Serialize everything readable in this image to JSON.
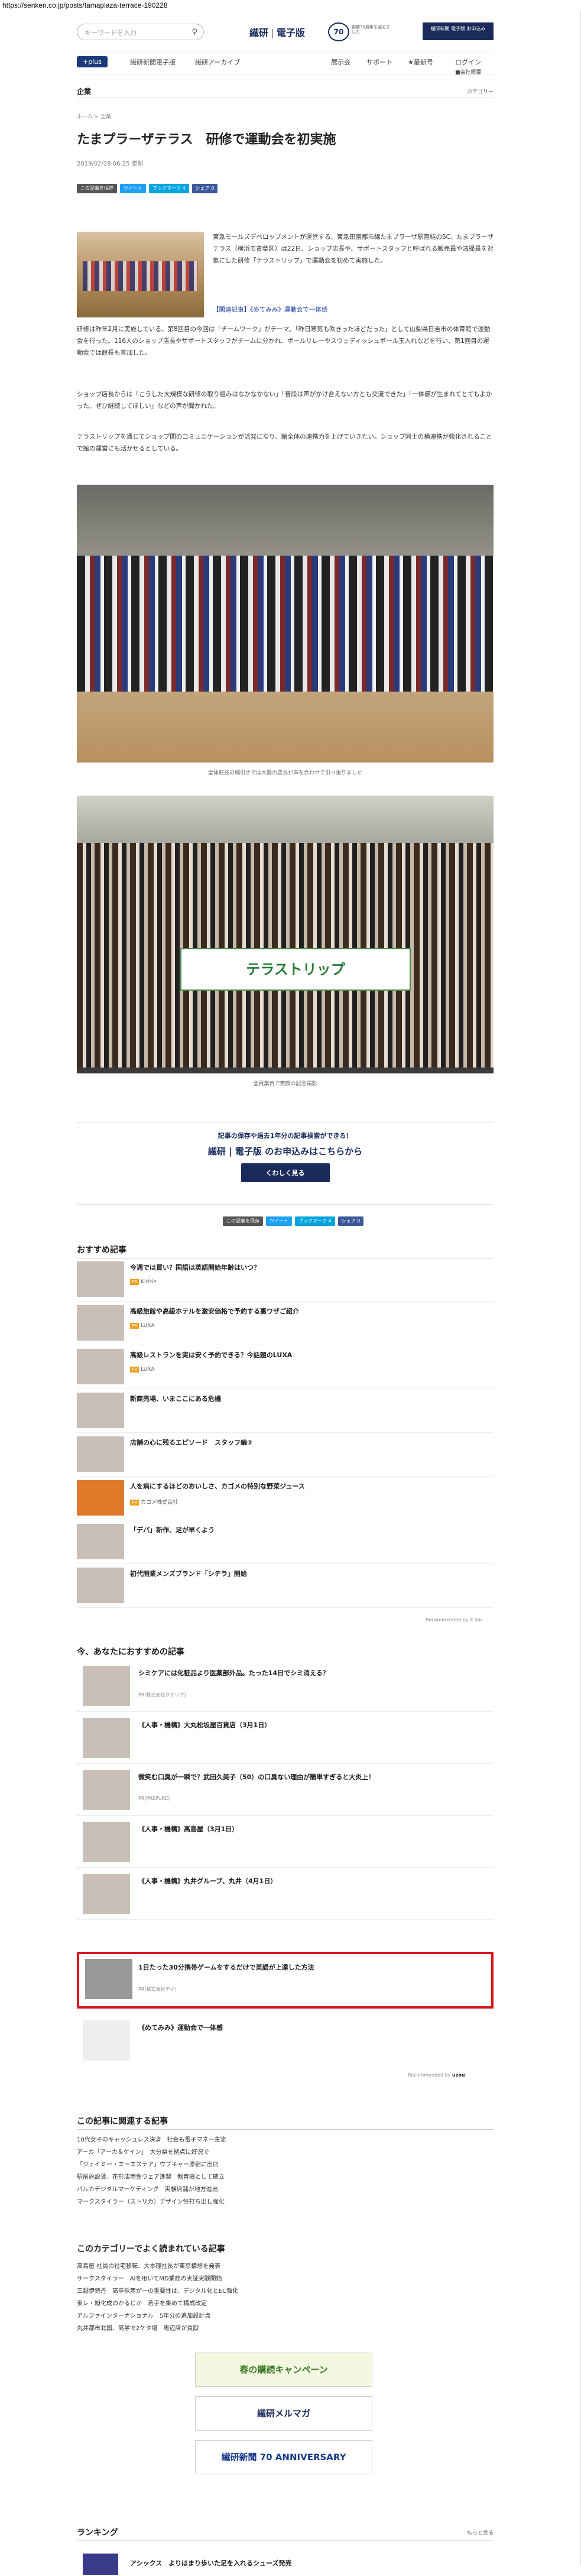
{
  "url": "https://senken.co.jp/posts/tamaplaza-terrace-190228",
  "header": {
    "search_placeholder": "キーワードを入力",
    "logo_main": "繊研",
    "logo_sub": "電子版",
    "anniv": "70",
    "logo_tagline": "創業70周年を迎えました",
    "right_label": "繊研新聞 電子版 お申込み"
  },
  "nav": {
    "plus": "+plus",
    "items": [
      "繊研新聞電子版",
      "繊研アーカイブ",
      "展示会",
      "サポート",
      "★最新号",
      "ログイン"
    ],
    "sub": "■会社概要"
  },
  "section": "企業",
  "category": "カテゴリー",
  "breadcrumb": "ホーム > 企業",
  "article": {
    "title": "たまプラーザテラス　研修で運動会を初実施",
    "date": "2019/02/28 06:25 更新",
    "p1": "東急モールズデベロップメントが運営する、東急田園都市線たまプラーザ駅直結のSC、たまプラーザテラス（横浜市青葉区）は22日、ショップ店長や、サポートスタッフと呼ばれる販売員や清掃員を対象にした研修「テラストリップ」で運動会を初めて実施した。",
    "related": "【関連記事】《めてみみ》運動会で一体感",
    "p2": "研修は昨年2月に実施している。第8回目の今回は「チームワーク」がテーマ。「昨日寒気も吹きったほどだった」として山梨県日吉市の体育館で運動会を行った。116人のショップ店長やサポートスタッフがチームに分かれ、ボールリレーやスウェディッシュポール玉入れなどを行い、第1回目の運動会では館長も参加した。",
    "p3": "ショップ店長からは「こうした大規模な研修の取り組みはなかなかない」「普段は声がかけ合えない方とも交流できた」「一体感が生まれてとてもよかった。ぜひ継続してほしい」などの声が聞かれた。",
    "p4": "テラストリップを通じてショップ間のコミュニケーションが活発になり、館全体の連携力を上げていきたい。ショップ同士の横連携が強化されることで館の運営にも活かせるとしている。",
    "caption1": "全体競技の綱引きでは大勢の店長が声を合わせて引っ張りました",
    "banner": "テラストリップ",
    "caption2": "全員集合で笑顔の記念撮影"
  },
  "share": {
    "save": "この記事を保存",
    "tweet": "ツイート",
    "hatena": "ブックマーク",
    "hatena_count": "4",
    "facebook": "シェア",
    "facebook_count": "0"
  },
  "promo": {
    "line1": "記事の保存や過去1年分の記事検索ができる！",
    "line2": "繊研 | 電子版 のお申込みはこちらから",
    "button": "くわしく見る"
  },
  "recommended": {
    "heading": "おすすめ記事",
    "items": [
      {
        "title": "今週では買い？国語は英語開始年齢はいつ？",
        "pr": "Kidsie"
      },
      {
        "title": "高級旅館や高級ホテルを激安価格で予約する裏ワザご紹介",
        "pr": "LUXA"
      },
      {
        "title": "高級レストランを実は安く予約できる？今話題のLUXA",
        "pr": "LUXA"
      },
      {
        "title": "新商売場、いまここにある危機",
        "pr": ""
      },
      {
        "title": "店舗の心に残るエピソード　スタッフ編②",
        "pr": ""
      },
      {
        "title": "人を病にするほどのおいしさ、カゴメの特別な野菜ジュース",
        "pr": "カゴメ株式会社"
      },
      {
        "title": "「デパ」新作、足が早くよう",
        "pr": ""
      },
      {
        "title": "初代開業メンズブランド「シテラ」開始",
        "pr": ""
      }
    ],
    "by": "Recommended by X-lab"
  },
  "now_rec": {
    "heading": "今、あなたにおすすめの記事",
    "items": [
      {
        "title": "シミケアには化粧品より医薬部外品。たった14日でシミ消える？",
        "pr": "PR(株式会社クオリア）"
      },
      {
        "title": "《人事・機構》大丸松坂屋百貨店（3月1日）",
        "pr": ""
      },
      {
        "title": "微笑む口臭が一瞬で？武田久美子（50）の口臭ない理由が簡単すぎると大炎上！",
        "pr": "PR(PREPURE)"
      },
      {
        "title": "《人事・機構》高島屋（3月1日）",
        "pr": ""
      },
      {
        "title": "《人事・機構》丸井グループ、丸井（4月1日）",
        "pr": ""
      },
      {
        "title": "1日たった30分携帯ゲームをするだけで英語が上達した方法",
        "pr": "PR(株式会社デイ)"
      },
      {
        "title": "《めてみみ》運動会で一体感",
        "pr": ""
      }
    ],
    "by": "Recommended by"
  },
  "related_articles": {
    "heading": "この記事に関連する記事",
    "items": [
      "10代女子のキャッシュレス決済　社会も電子マネー主流",
      "アーカ「アーカ＆ケイン」　大分県を拠点に好況で",
      "「ジェイミー・エーエステア」ウブキャー原宿に出店",
      "駅前施設賃、花形店雨性ウェア進製　教育機として確立",
      "バルカデジタルマーケティング　実験店舗が地方進出",
      "マークスタイラー（ストリカ）デザイン性打ち出し強化"
    ]
  },
  "category_articles": {
    "heading": "このカテゴリーでよく読まれている記事",
    "items": [
      "高島屋 社員の社宅移転、大本理社長が東京構想を発表",
      "サークスタイラー　AIを用いてMD業務の実証実験開始",
      "三越伊勢丹　高卒採用が一の重要性は、デジタル化とEC強化",
      "東レ・旭化成のかるじか　若手を集めて構成改定",
      "アルファインターナショナル　5年分の追加設計点",
      "丸井都市北国、高学で2ケタ増　周辺店が貢献"
    ]
  },
  "banners": {
    "spring": "春の購読キャンペーン",
    "mail": "繊研メルマガ",
    "anniv": "繊研新聞 70 ANNIVERSARY"
  },
  "ranking": {
    "heading": "ランキング",
    "more": "もっと見る",
    "first": "アシックス　よりはまり歩いた足を入れるシューズ発売"
  }
}
